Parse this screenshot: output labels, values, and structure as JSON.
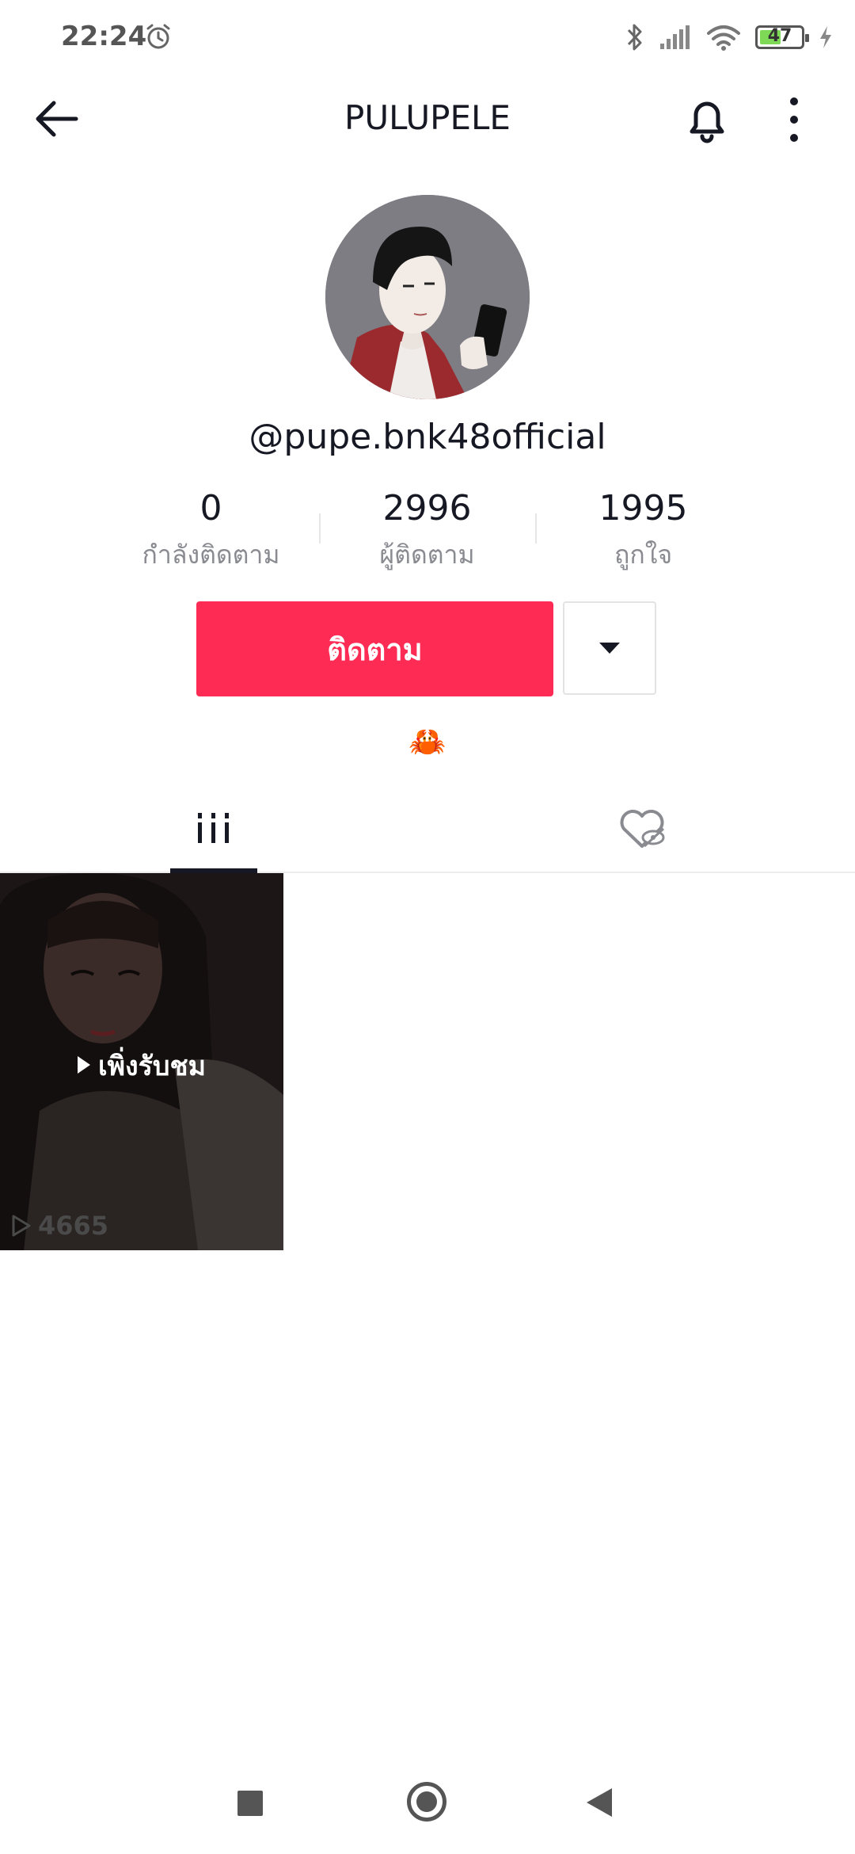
{
  "status_bar": {
    "time": "22:24",
    "battery_level": "47",
    "battery_percent": 47,
    "icons": [
      "alarm-icon",
      "bluetooth-icon",
      "signal-icon",
      "wifi-icon",
      "battery-icon",
      "charging-icon"
    ]
  },
  "header": {
    "title": "PULUPELE",
    "icons": [
      "back-arrow-icon",
      "bell-icon",
      "more-vertical-icon"
    ]
  },
  "profile": {
    "username": "@pupe.bnk48official",
    "stats": [
      {
        "value": "0",
        "label": "กำลังติดตาม"
      },
      {
        "value": "2996",
        "label": "ผู้ติดตาม"
      },
      {
        "value": "1995",
        "label": "ถูกใจ"
      }
    ],
    "follow_label": "ติดตาม",
    "bio": "🦀"
  },
  "tabs": [
    {
      "name": "videos",
      "icon": "grid-icon",
      "active": true
    },
    {
      "name": "liked",
      "icon": "liked-hidden-icon",
      "active": false
    }
  ],
  "videos": [
    {
      "label": "เพิ่งรับชม",
      "views": "4665"
    }
  ],
  "nav_bar": {
    "icons": [
      "recents-icon",
      "home-icon",
      "back-icon"
    ]
  },
  "colors": {
    "accent": "#fe2c55",
    "text": "#161823",
    "secondary_text": "#8a8b91",
    "battery": "#7ed957"
  }
}
